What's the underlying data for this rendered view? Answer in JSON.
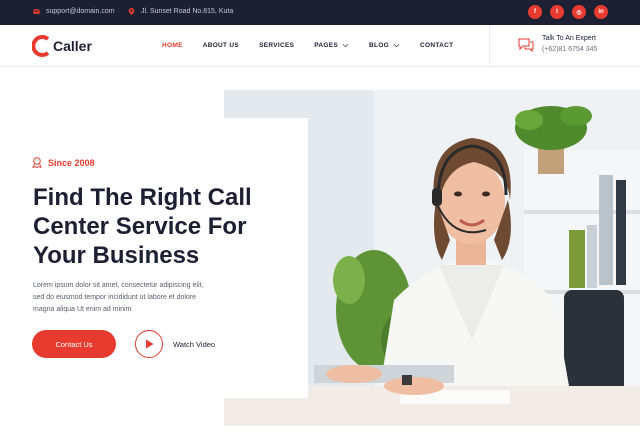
{
  "topbar": {
    "email": "support@domain.com",
    "address": "Jl. Sunset Road No.815, Kuta",
    "social": [
      {
        "icon": "facebook-icon",
        "glyph": "f"
      },
      {
        "icon": "twitter-icon",
        "glyph": "t"
      },
      {
        "icon": "instagram-icon",
        "glyph": "◎"
      },
      {
        "icon": "linkedin-icon",
        "glyph": "in"
      }
    ]
  },
  "header": {
    "logo_text": "Caller",
    "nav": [
      {
        "label": "HOME",
        "active": true,
        "dropdown": false
      },
      {
        "label": "ABOUT US",
        "active": false,
        "dropdown": false
      },
      {
        "label": "SERVICES",
        "active": false,
        "dropdown": false
      },
      {
        "label": "PAGES",
        "active": false,
        "dropdown": true
      },
      {
        "label": "BLOG",
        "active": false,
        "dropdown": true
      },
      {
        "label": "CONTACT",
        "active": false,
        "dropdown": false
      }
    ],
    "expert_title": "Talk To An Expert",
    "expert_phone": "(+62)81 6754 345"
  },
  "hero": {
    "since": "Since 2008",
    "title_lines": [
      "Find The Right Call",
      "Center Service For",
      "Your Business"
    ],
    "desc_lines": [
      "Lorem ipsum dolor sit amet, consectetur adipiscing elit,",
      "sed do eiusmod tempor incididunt ut labore et dolore",
      "magna aliqua Ut enim ad minim"
    ],
    "cta_label": "Contact Us",
    "video_label": "Watch Video"
  },
  "colors": {
    "accent": "#e63b2e",
    "dark": "#1d1f33"
  }
}
